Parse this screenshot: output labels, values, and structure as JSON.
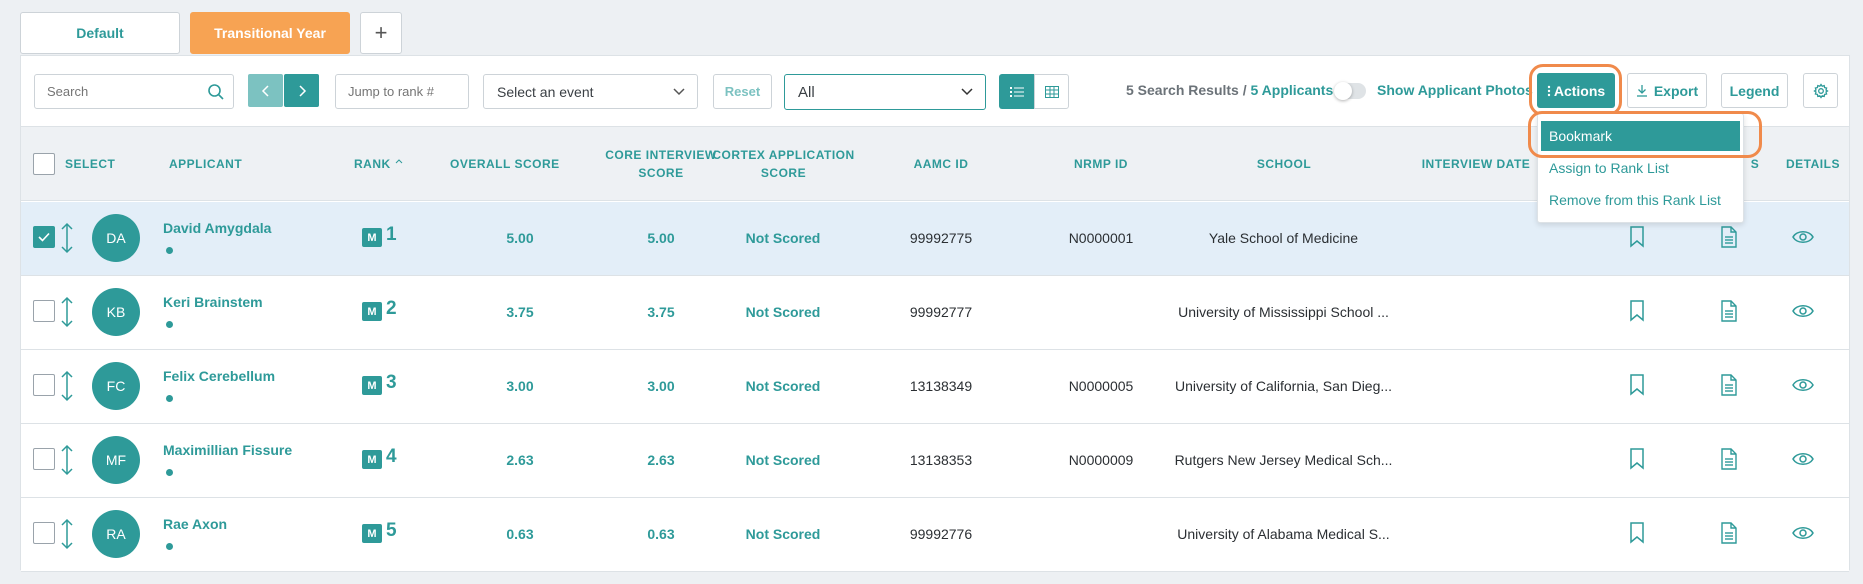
{
  "tabs": [
    {
      "label": "Default"
    },
    {
      "label": "Transitional Year"
    },
    {
      "label": "+"
    }
  ],
  "toolbar": {
    "search_placeholder": "Search",
    "jump_placeholder": "Jump to rank #",
    "event_placeholder": "Select an event",
    "reset_label": "Reset",
    "filter_value": "All",
    "results_count_text": "5 Search Results",
    "results_separator": " / ",
    "applicants_count_text": "5 Applicants",
    "show_photos_label": "Show Applicant Photos",
    "actions_label": "Actions",
    "export_label": "Export",
    "legend_label": "Legend"
  },
  "columns": {
    "select": "SELECT",
    "applicant": "APPLICANT",
    "rank": "RANK",
    "overall_score": "OVERALL SCORE",
    "core_interview_1": "CORE INTERVIEW",
    "core_interview_2": "SCORE",
    "cortex_1": "CORTEX APPLICATION",
    "cortex_2": "SCORE",
    "aamc_id": "AAMC ID",
    "nrmp_id": "NRMP ID",
    "school": "SCHOOL",
    "interview_date": "INTERVIEW DATE",
    "hidden_col_fragment": "S",
    "details": "DETAILS"
  },
  "actions_menu": {
    "items": [
      {
        "label": "Bookmark"
      },
      {
        "label": "Assign to Rank List"
      },
      {
        "label": "Remove from this Rank List"
      }
    ]
  },
  "rows": [
    {
      "initials": "DA",
      "name": "David Amygdala",
      "badge": "M",
      "rank": "1",
      "overall": "5.00",
      "core": "5.00",
      "cortex": "Not Scored",
      "aamc": "99992775",
      "nrmp": "N0000001",
      "school": "Yale School of Medicine",
      "selected": true
    },
    {
      "initials": "KB",
      "name": "Keri Brainstem",
      "badge": "M",
      "rank": "2",
      "overall": "3.75",
      "core": "3.75",
      "cortex": "Not Scored",
      "aamc": "99992777",
      "nrmp": "",
      "school": "University of Mississippi School ...",
      "selected": false
    },
    {
      "initials": "FC",
      "name": "Felix Cerebellum",
      "badge": "M",
      "rank": "3",
      "overall": "3.00",
      "core": "3.00",
      "cortex": "Not Scored",
      "aamc": "13138349",
      "nrmp": "N0000005",
      "school": "University of California, San Dieg...",
      "selected": false
    },
    {
      "initials": "MF",
      "name": "Maximillian Fissure",
      "badge": "M",
      "rank": "4",
      "overall": "2.63",
      "core": "2.63",
      "cortex": "Not Scored",
      "aamc": "13138353",
      "nrmp": "N0000009",
      "school": "Rutgers New Jersey Medical Sch...",
      "selected": false
    },
    {
      "initials": "RA",
      "name": "Rae Axon",
      "badge": "M",
      "rank": "5",
      "overall": "0.63",
      "core": "0.63",
      "cortex": "Not Scored",
      "aamc": "99992776",
      "nrmp": "",
      "school": "University of Alabama Medical S...",
      "selected": false
    }
  ],
  "colors": {
    "accent": "#2e9a99",
    "active_tab": "#f7a353",
    "highlight_ring": "#f08a4b",
    "selected_row": "#e3eef8"
  }
}
